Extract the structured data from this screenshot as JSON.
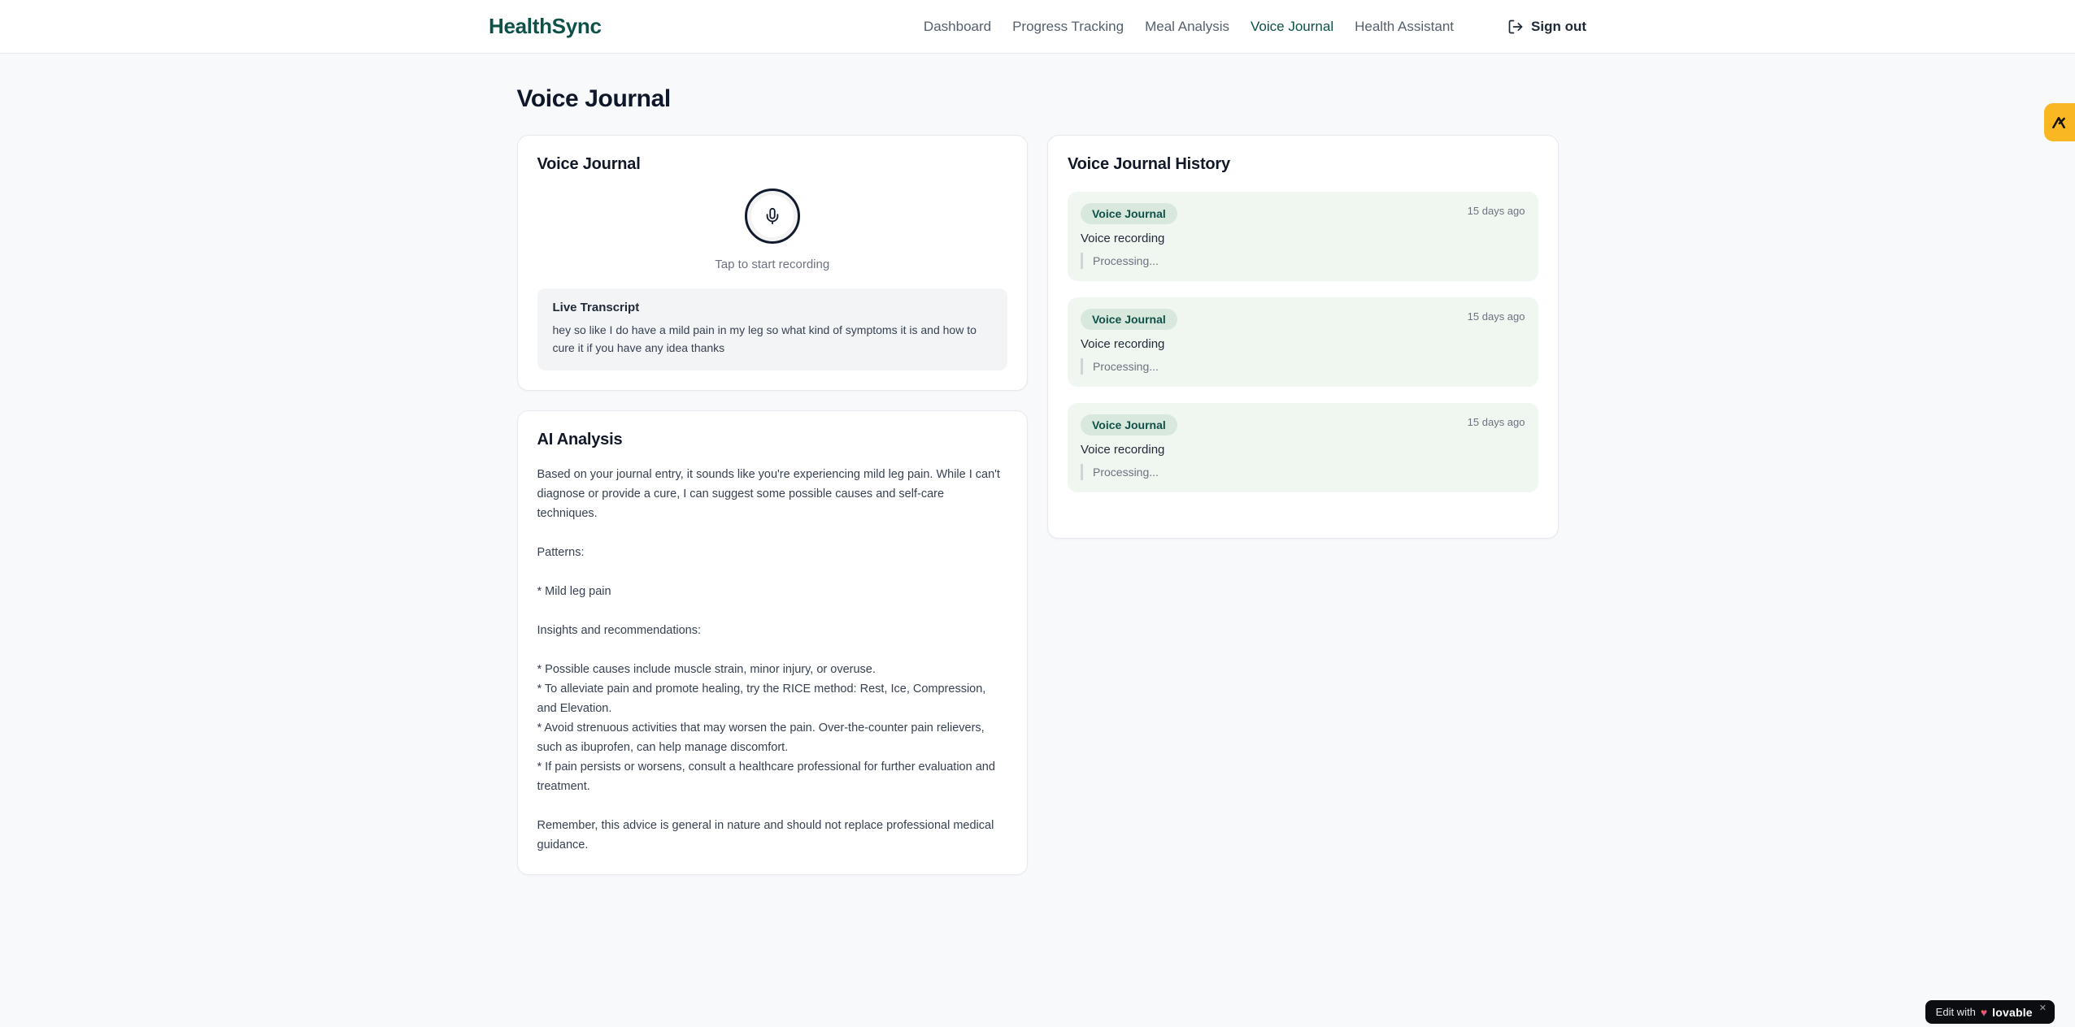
{
  "brand": {
    "name": "HealthSync"
  },
  "nav": {
    "items": [
      {
        "label": "Dashboard",
        "active": false
      },
      {
        "label": "Progress Tracking",
        "active": false
      },
      {
        "label": "Meal Analysis",
        "active": false
      },
      {
        "label": "Voice Journal",
        "active": true
      },
      {
        "label": "Health Assistant",
        "active": false
      }
    ],
    "sign_out_label": "Sign out"
  },
  "page": {
    "title": "Voice Journal"
  },
  "recorder_card": {
    "title": "Voice Journal",
    "tap_hint": "Tap to start recording",
    "transcript_title": "Live Transcript",
    "transcript_text": "hey so like I do have a mild pain in my leg so what kind of symptoms it is and how to cure it if you have any idea thanks"
  },
  "analysis_card": {
    "title": "AI Analysis",
    "body": "Based on your journal entry, it sounds like you're experiencing mild leg pain. While I can't diagnose or provide a cure, I can suggest some possible causes and self-care techniques.\n\nPatterns:\n\n* Mild leg pain\n\nInsights and recommendations:\n\n* Possible causes include muscle strain, minor injury, or overuse.\n* To alleviate pain and promote healing, try the RICE method: Rest, Ice, Compression, and Elevation.\n* Avoid strenuous activities that may worsen the pain. Over-the-counter pain relievers, such as ibuprofen, can help manage discomfort.\n* If pain persists or worsens, consult a healthcare professional for further evaluation and treatment.\n\nRemember, this advice is general in nature and should not replace professional medical guidance."
  },
  "history_card": {
    "title": "Voice Journal History",
    "entries": [
      {
        "badge": "Voice Journal",
        "time": "15 days ago",
        "title": "Voice recording",
        "status": "Processing..."
      },
      {
        "badge": "Voice Journal",
        "time": "15 days ago",
        "title": "Voice recording",
        "status": "Processing..."
      },
      {
        "badge": "Voice Journal",
        "time": "15 days ago",
        "title": "Voice recording",
        "status": "Processing..."
      }
    ]
  },
  "edit_badge": {
    "prefix": "Edit with",
    "brand": "lovable",
    "close": "✕"
  },
  "icons": {
    "mic": "mic-icon",
    "sign_out": "log-out-icon",
    "edge_tab": "a-mark-icon",
    "heart": "gradient-heart-icon"
  },
  "colors": {
    "accent_teal": "#0d5148",
    "nav_inactive": "#55606e",
    "page_bg": "#f8f9fb",
    "card_border": "#e7e9ee",
    "entry_bg": "#f0f7f1",
    "badge_bg": "#d8e8dd",
    "transcript_bg": "#f3f4f6",
    "amber_tab": "#f9b822",
    "lovable_bg": "#0c0d10"
  }
}
